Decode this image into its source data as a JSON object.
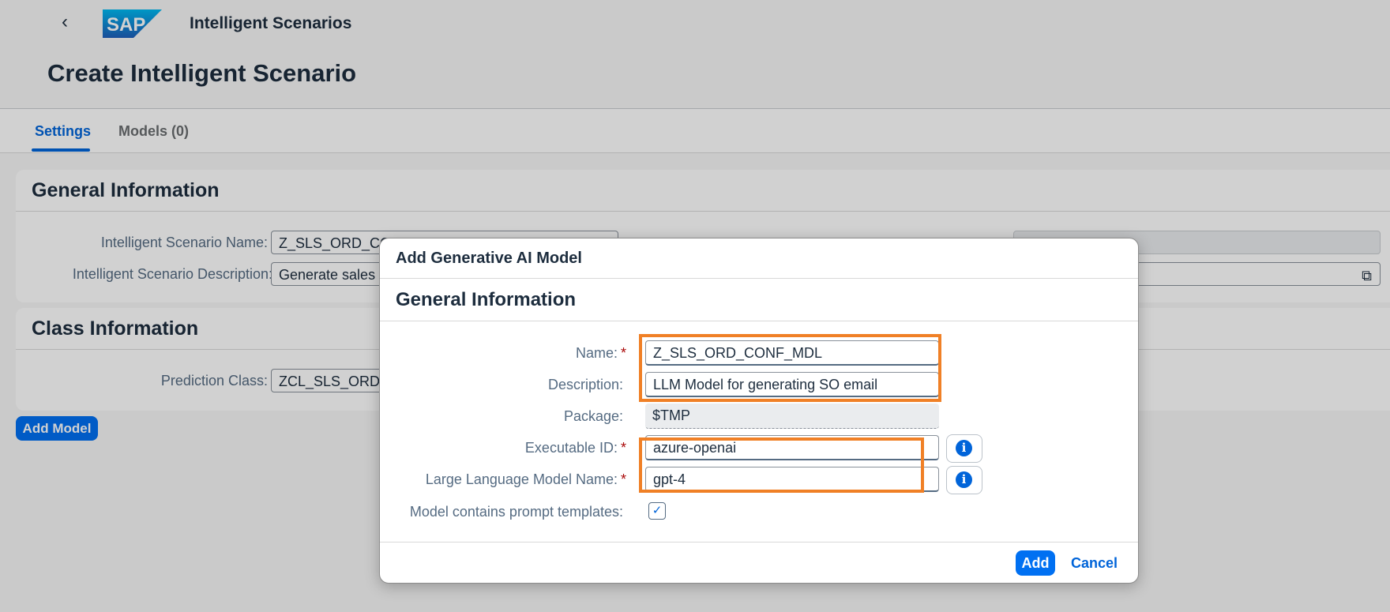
{
  "shell": {
    "app_title": "Intelligent Scenarios",
    "logo_text": "SAP"
  },
  "page": {
    "title": "Create Intelligent Scenario"
  },
  "tabs": [
    {
      "label": "Settings",
      "selected": true
    },
    {
      "label": "Models (0)",
      "selected": false
    }
  ],
  "general_info": {
    "title": "General Information",
    "name_label": "Intelligent Scenario Name:",
    "name_value": "Z_SLS_ORD_CONF_SCN",
    "desc_label": "Intelligent Scenario Description:",
    "desc_value": "Generate sales c"
  },
  "class_info": {
    "title": "Class Information",
    "prediction_label": "Prediction Class:",
    "prediction_value": "ZCL_SLS_ORD_"
  },
  "add_model_label": "Add Model",
  "dialog": {
    "title": "Add Generative AI Model",
    "section_title": "General Information",
    "fields": {
      "name": {
        "label": "Name:",
        "value": "Z_SLS_ORD_CONF_MDL"
      },
      "description": {
        "label": "Description:",
        "value": "LLM Model for generating SO email"
      },
      "package": {
        "label": "Package:",
        "value": "$TMP"
      },
      "executable_id": {
        "label": "Executable ID:",
        "value": "azure-openai"
      },
      "llm_name": {
        "label": "Large Language Model Name:",
        "value": "gpt-4"
      },
      "prompt_templates": {
        "label": "Model contains prompt templates:",
        "checked": true
      }
    },
    "add_label": "Add",
    "cancel_label": "Cancel"
  },
  "colors": {
    "brand": "#0070f2",
    "highlight": "#f08026",
    "required": "#aa0808"
  }
}
